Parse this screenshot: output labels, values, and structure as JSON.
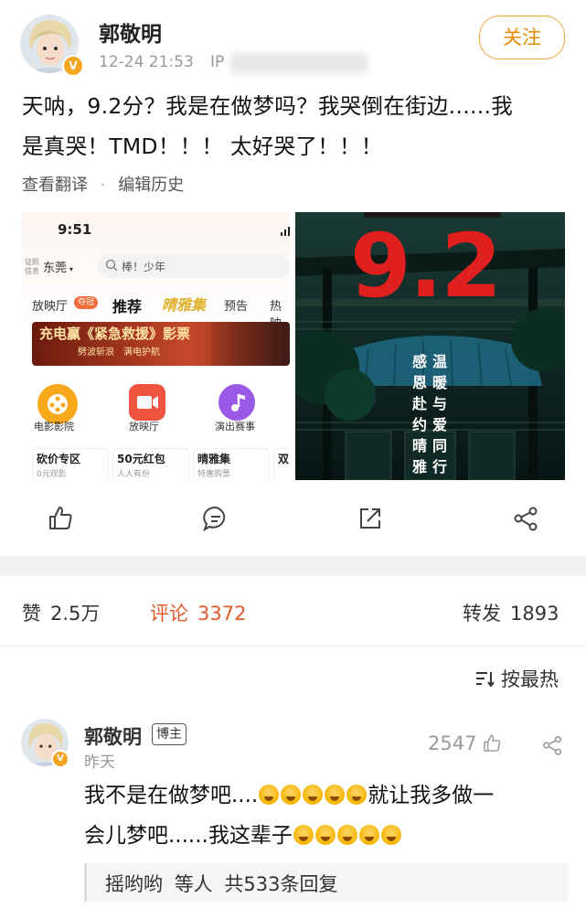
{
  "post": {
    "author": "郭敬明",
    "time": "12-24 21:53",
    "ip_label": "IP",
    "follow_label": "关注",
    "text_line1": "天呐，9.2分？我是在做梦吗？我哭倒在街边......我",
    "text_line2": "是真哭！TMD！！！ 太好哭了！！！",
    "translate_label": "查看翻译",
    "dot": "·",
    "edit_history_label": "编辑历史"
  },
  "embed_left": {
    "clock": "9:51",
    "license_label_1": "证照",
    "license_label_2": "信息",
    "city": "东莞",
    "search_text": "棒！少年",
    "tabs": [
      "放映厅",
      "推荐",
      "晴雅集",
      "预告",
      "热映"
    ],
    "tab_badge": "夺冠",
    "banner_text": "充电赢《紧急救援》影票",
    "banner_sub_1": "劈波斩浪",
    "banner_sub_2": "满电护航",
    "icons": [
      {
        "label": "电影影院",
        "color": "#f7a81b"
      },
      {
        "label": "放映厅",
        "color": "#f0533f"
      },
      {
        "label": "演出赛事",
        "color": "#9b59e8"
      }
    ],
    "cards": [
      "砍价专区",
      "50元红包",
      "晴雅集",
      "双"
    ],
    "cards_sub": [
      "0元观影",
      "人人有份",
      "特惠购票",
      ""
    ]
  },
  "embed_right": {
    "score": "9.2",
    "poem_right": "温暖与爱同行",
    "poem_left": "感恩赴约晴雅"
  },
  "stats": {
    "likes_label": "赞",
    "likes_value": "2.5万",
    "comments_label": "评论",
    "comments_value": "3372",
    "reposts_label": "转发",
    "reposts_value": "1893"
  },
  "sort": {
    "label": "按最热"
  },
  "comment": {
    "author": "郭敬明",
    "tag": "博主",
    "time": "昨天",
    "likes": "2547",
    "text_a": "我不是在做梦吧....",
    "text_b": "就让我多做一",
    "text_c": "会儿梦吧......我这辈子",
    "replies_name": "摇哟哟",
    "replies_mid": "等人",
    "replies_count": "共533条回复"
  },
  "colors": {
    "accent_orange": "#e68a00",
    "comment_red": "#e05a2a",
    "poster_bg": "#0d2420",
    "score_red": "#e0201f"
  }
}
